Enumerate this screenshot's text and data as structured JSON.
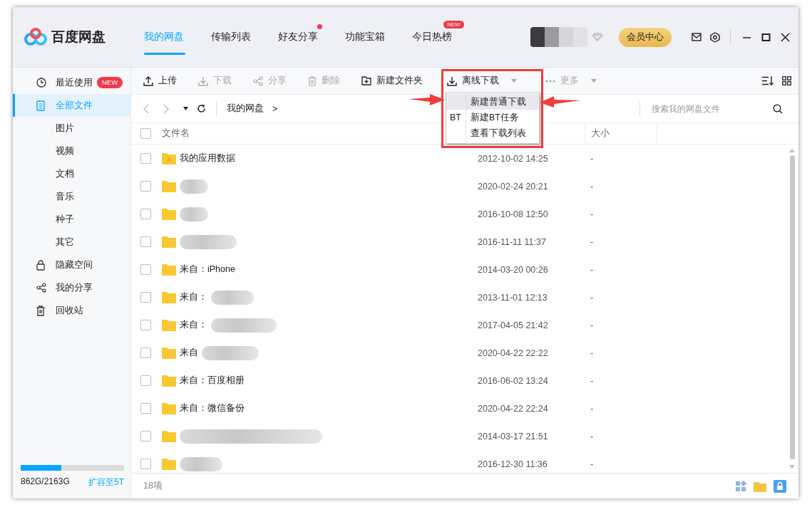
{
  "app": {
    "name": "百度网盘"
  },
  "nav_tabs": [
    {
      "label": "我的网盘",
      "selected": true
    },
    {
      "label": "传输列表",
      "selected": false
    },
    {
      "label": "好友分享",
      "selected": false,
      "dot": true
    },
    {
      "label": "功能宝箱",
      "selected": false
    },
    {
      "label": "今日热榜",
      "selected": false,
      "badge": "NEW"
    }
  ],
  "header": {
    "vip_button": "会员中心"
  },
  "sidebar": {
    "items": [
      {
        "label": "最近使用",
        "selected": false,
        "badge": "NEW"
      },
      {
        "label": "全部文件",
        "selected": true,
        "children": [
          {
            "label": "图片",
            "selected": false
          },
          {
            "label": "视频",
            "selected": false
          },
          {
            "label": "文档",
            "selected": false
          },
          {
            "label": "音乐",
            "selected": false
          },
          {
            "label": "种子",
            "selected": false
          },
          {
            "label": "其它",
            "selected": false
          }
        ]
      },
      {
        "label": "隐藏空间",
        "selected": false
      },
      {
        "label": "我的分享",
        "selected": false
      },
      {
        "label": "回收站",
        "selected": false
      }
    ],
    "storage": {
      "usage": "862G/2163G",
      "level": 0.39,
      "expand_link": "扩容至5T"
    }
  },
  "toolbar": [
    {
      "label": "上传",
      "disabled": false
    },
    {
      "label": "下载",
      "disabled": true
    },
    {
      "label": "分享",
      "disabled": true
    },
    {
      "label": "删除",
      "disabled": true
    },
    {
      "label": "新建文件夹",
      "disabled": false
    },
    {
      "label": "离线下载",
      "disabled": false,
      "dropdown": true,
      "expanded": true
    },
    {
      "label": "更多",
      "disabled": true,
      "dropdown": true,
      "expanded": false
    }
  ],
  "dropdown_menu": [
    {
      "label": "新建普通下载",
      "selected": true
    },
    {
      "label": "新建BT任务",
      "prefix": "BT",
      "selected": false
    },
    {
      "label": "查看下载列表",
      "selected": false
    }
  ],
  "breadcrumb": {
    "path": "我的网盘",
    "separator": ">"
  },
  "search": {
    "placeholder": "搜索我的网盘文件"
  },
  "table": {
    "columns": [
      "文件名",
      "大小"
    ],
    "all_checked": false,
    "rows": [
      {
        "checked": false,
        "name": "我的应用数据",
        "redacted": false,
        "app_folder": true,
        "modified": "2012-10-02 14:25",
        "size": "-"
      },
      {
        "checked": false,
        "redacted": true,
        "modified": "2020-02-24 20:21",
        "size": "-"
      },
      {
        "checked": false,
        "redacted": true,
        "modified": "2016-10-08 12:50",
        "size": "-"
      },
      {
        "checked": false,
        "redacted": true,
        "modified": "2016-11-11 11:37",
        "size": "-"
      },
      {
        "checked": false,
        "name": "来自：iPhone",
        "redacted": false,
        "modified": "2014-03-20 00:26",
        "size": "-"
      },
      {
        "checked": false,
        "name": "来自：",
        "redacted": true,
        "modified": "2013-11-01 12:13",
        "size": "-"
      },
      {
        "checked": false,
        "name": "来自：",
        "redacted": true,
        "modified": "2017-04-05 21:42",
        "size": "-"
      },
      {
        "checked": false,
        "name": "来自",
        "redacted": true,
        "modified": "2020-04-22 22:22",
        "size": "-"
      },
      {
        "checked": false,
        "name": "来自：百度相册",
        "redacted": false,
        "modified": "2016-06-02 13:24",
        "size": "-"
      },
      {
        "checked": false,
        "name": "来自：微信备份",
        "redacted": false,
        "modified": "2020-04-22 22:24",
        "size": "-"
      },
      {
        "checked": false,
        "redacted": true,
        "modified": "2014-03-17 21:51",
        "size": "-"
      },
      {
        "checked": false,
        "redacted": true,
        "modified": "2016-12-30 11:36",
        "size": "-"
      }
    ]
  },
  "status_bar": {
    "count": "18项"
  }
}
